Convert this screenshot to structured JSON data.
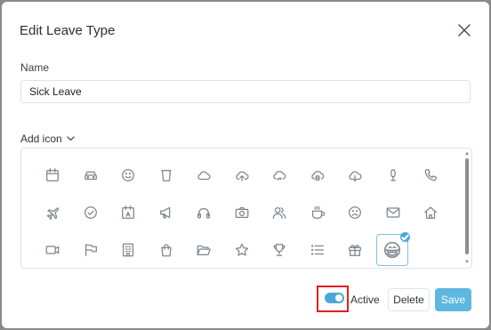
{
  "dialog": {
    "title": "Edit Leave Type",
    "name_label": "Name",
    "name_value": "Sick Leave",
    "add_icon_label": "Add icon",
    "active_label": "Active",
    "active": true,
    "delete_label": "Delete",
    "save_label": "Save"
  },
  "icons": [
    [
      "calendar-icon",
      "car-icon",
      "smile-icon",
      "cup-icon",
      "cloud-icon",
      "cloud-upload-icon",
      "cloud-sync-icon",
      "cloud-server-icon",
      "cloud-download-icon",
      "microphone-icon",
      "phone-icon"
    ],
    [
      "airplane-icon",
      "check-circle-icon",
      "calendar-a-icon",
      "megaphone-icon",
      "headphones-icon",
      "camera-icon",
      "user-group-icon",
      "coffee-icon",
      "sad-face-icon",
      "mail-icon",
      "home-icon"
    ],
    [
      "video-icon",
      "flags-icon",
      "building-icon",
      "shopping-bag-icon",
      "folder-open-icon",
      "star-icon",
      "trophy-icon",
      "list-icon",
      "gift-icon",
      "sick-mask-face-icon"
    ]
  ],
  "selected_icon": "sick-mask-face-icon",
  "colors": {
    "accent": "#5db7df",
    "toggle": "#4aa8d8",
    "icon_stroke": "#7d858e",
    "highlight": "#e02020"
  }
}
